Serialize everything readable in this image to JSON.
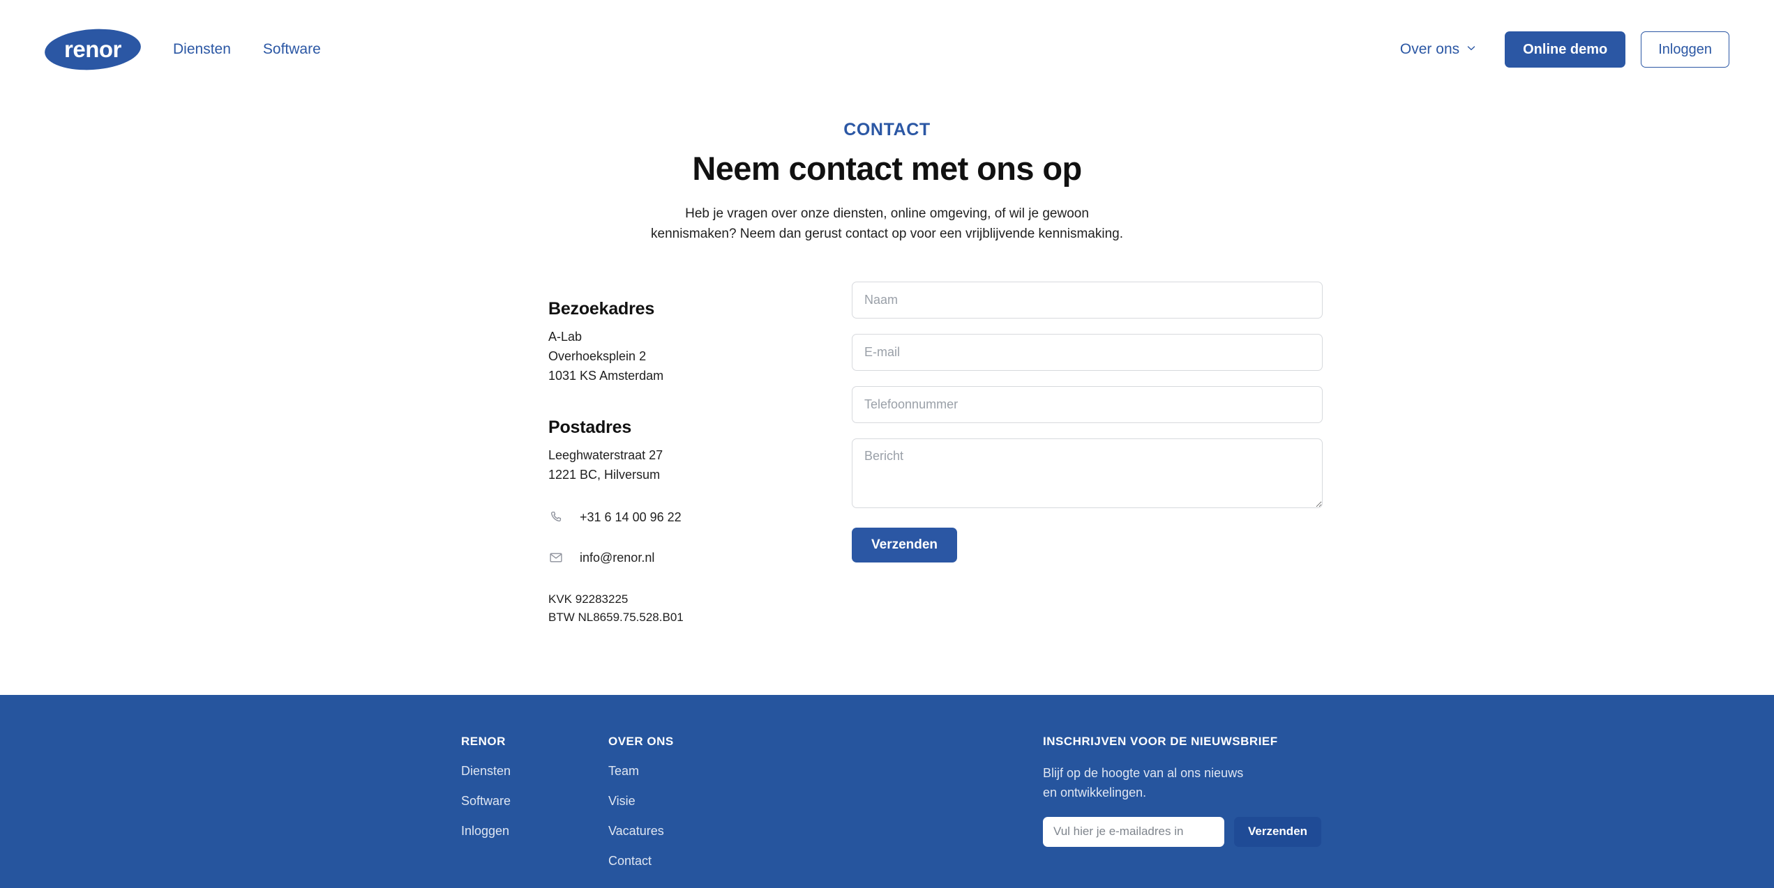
{
  "header": {
    "logo_text": "renor",
    "nav": [
      {
        "label": "Diensten"
      },
      {
        "label": "Software"
      }
    ],
    "dropdown_label": "Over ons",
    "dropdown_icon": "chevron-down-icon",
    "demo_button": "Online demo",
    "login_button": "Inloggen"
  },
  "hero": {
    "eyebrow": "CONTACT",
    "title": "Neem contact met ons op",
    "subtitle": "Heb je vragen over onze diensten, online omgeving, of wil je gewoon kennismaken? Neem dan gerust contact op voor een vrijblijvende kennismaking."
  },
  "contact_info": {
    "visit_heading": "Bezoekadres",
    "visit_line1": "A-Lab",
    "visit_line2": "Overhoeksplein 2",
    "visit_line3": "1031 KS Amsterdam",
    "postal_heading": "Postadres",
    "postal_line1": "Leeghwaterstraat 27",
    "postal_line2": "1221 BC, Hilversum",
    "phone_icon": "phone-icon",
    "phone": "+31 6 14 00 96 22",
    "email_icon": "envelope-icon",
    "email": "info@renor.nl",
    "kvk": "KVK 92283225",
    "btw": "BTW NL8659.75.528.B01"
  },
  "form": {
    "name_placeholder": "Naam",
    "name_value": "",
    "email_placeholder": "E-mail",
    "email_value": "",
    "phone_placeholder": "Telefoonnummer",
    "phone_value": "",
    "message_placeholder": "Bericht",
    "message_value": "",
    "submit_label": "Verzenden"
  },
  "footer": {
    "col1_title": "RENOR",
    "col1_links": [
      {
        "label": "Diensten"
      },
      {
        "label": "Software"
      },
      {
        "label": "Inloggen"
      }
    ],
    "col2_title": "OVER ONS",
    "col2_links": [
      {
        "label": "Team"
      },
      {
        "label": "Visie"
      },
      {
        "label": "Vacatures"
      },
      {
        "label": "Contact"
      }
    ],
    "newsletter_title": "INSCHRIJVEN VOOR DE NIEUWSBRIEF",
    "newsletter_desc": "Blijf op de hoogte van al ons nieuws en ontwikkelingen.",
    "newsletter_placeholder": "Vul hier je e-mailadres in",
    "newsletter_value": "",
    "newsletter_button": "Verzenden"
  },
  "colors": {
    "brand_blue": "#2B57A4",
    "footer_blue": "#26559E",
    "footer_button_blue": "#1F4B96",
    "text_dark": "#111111",
    "placeholder_grey": "#9aa0a8",
    "border_grey": "#d7d9dd"
  }
}
